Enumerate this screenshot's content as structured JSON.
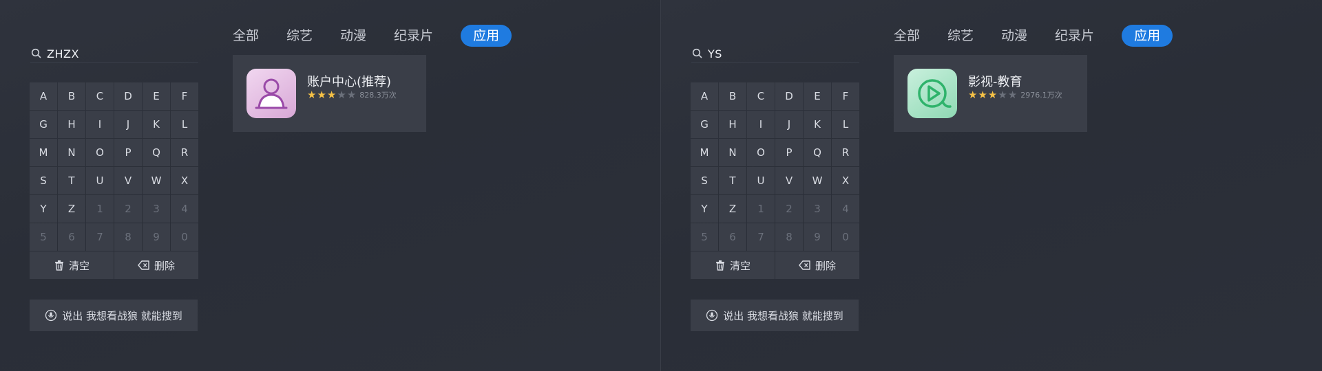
{
  "screens": [
    {
      "query": "ZHZX",
      "keys": [
        "A",
        "B",
        "C",
        "D",
        "E",
        "F",
        "G",
        "H",
        "I",
        "J",
        "K",
        "L",
        "M",
        "N",
        "O",
        "P",
        "Q",
        "R",
        "S",
        "T",
        "U",
        "V",
        "W",
        "X",
        "Y",
        "Z",
        "1",
        "2",
        "3",
        "4",
        "5",
        "6",
        "7",
        "8",
        "9",
        "0"
      ],
      "clear_label": "清空",
      "delete_label": "删除",
      "voice_hint": "说出 我想看战狼 就能搜到",
      "tabs": [
        "全部",
        "综艺",
        "动漫",
        "纪录片",
        "应用"
      ],
      "active_tab": "应用",
      "result": {
        "name": "账户中心(推荐)",
        "rating": 3,
        "max_rating": 5,
        "downloads": "828.3万次",
        "icon": "account-user-icon"
      }
    },
    {
      "query": "YS",
      "keys": [
        "A",
        "B",
        "C",
        "D",
        "E",
        "F",
        "G",
        "H",
        "I",
        "J",
        "K",
        "L",
        "M",
        "N",
        "O",
        "P",
        "Q",
        "R",
        "S",
        "T",
        "U",
        "V",
        "W",
        "X",
        "Y",
        "Z",
        "1",
        "2",
        "3",
        "4",
        "5",
        "6",
        "7",
        "8",
        "9",
        "0"
      ],
      "clear_label": "清空",
      "delete_label": "删除",
      "voice_hint": "说出 我想看战狼 就能搜到",
      "tabs": [
        "全部",
        "综艺",
        "动漫",
        "纪录片",
        "应用"
      ],
      "active_tab": "应用",
      "result": {
        "name": "影视-教育",
        "rating": 3,
        "max_rating": 5,
        "downloads": "2976.1万次",
        "icon": "video-play-icon"
      }
    }
  ],
  "colors": {
    "accent": "#1f7be0",
    "star_on": "#f5c146",
    "star_off": "#6b707b",
    "key_bg": "#3a3e48"
  }
}
